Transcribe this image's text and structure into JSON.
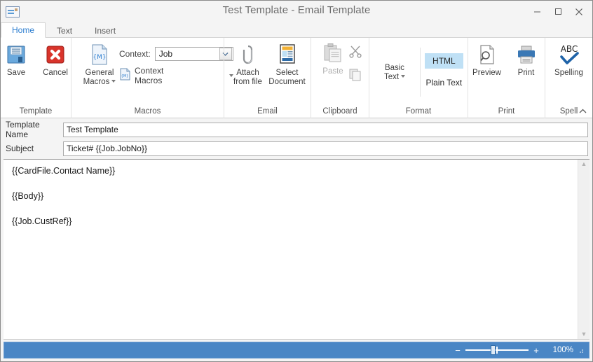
{
  "window": {
    "title": "Test Template - Email Template",
    "icon": "email-template-icon",
    "minimize_label": "Minimize",
    "maximize_label": "Maximize",
    "close_label": "Close"
  },
  "tabs": [
    {
      "label": "Home",
      "active": true
    },
    {
      "label": "Text",
      "active": false
    },
    {
      "label": "Insert",
      "active": false
    }
  ],
  "ribbon": {
    "collapse_label": "Collapse Ribbon",
    "groups": [
      {
        "label": "Template",
        "buttons": [
          {
            "label": "Save",
            "icon": "save-floppy-icon"
          },
          {
            "label": "Cancel",
            "icon": "cancel-x-icon"
          }
        ]
      },
      {
        "label": "Macros",
        "general_macros": {
          "label_line1": "General",
          "label_line2": "Macros",
          "icon": "general-macros-icon"
        },
        "context_label": "Context:",
        "context_value": "Job",
        "context_macros_label": "Context Macros",
        "context_macros_icon": "context-macros-icon"
      },
      {
        "label": "Email",
        "buttons": [
          {
            "label_line1": "Attach",
            "label_line2": "from file",
            "icon": "paperclip-icon"
          },
          {
            "label_line1": "Select",
            "label_line2": "Document",
            "icon": "document-icon"
          }
        ]
      },
      {
        "label": "Clipboard",
        "paste_label": "Paste",
        "paste_icon": "paste-icon",
        "cut_icon": "scissors-icon",
        "copy_icon": "copy-icon"
      },
      {
        "label": "Format",
        "basic_text_line1": "Basic",
        "basic_text_line2": "Text",
        "basic_text_icon": "basic-text-icon",
        "options": [
          {
            "label": "HTML",
            "selected": true
          },
          {
            "label": "Plain Text",
            "selected": false
          }
        ]
      },
      {
        "label": "Print",
        "buttons": [
          {
            "label": "Preview",
            "icon": "print-preview-icon"
          },
          {
            "label": "Print",
            "icon": "printer-icon"
          }
        ]
      },
      {
        "label": "Spell",
        "buttons": [
          {
            "label": "Spelling",
            "icon": "spell-check-icon"
          }
        ]
      }
    ]
  },
  "form": {
    "template_name_label": "Template Name",
    "template_name_value": "Test Template",
    "template_name_placeholder": "",
    "subject_label": "Subject",
    "subject_value": "Ticket# {{Job.JobNo}}",
    "subject_placeholder": ""
  },
  "editor": {
    "lines": [
      "{{CardFile.Contact Name}}",
      "{{Body}}",
      "{{Job.CustRef}}"
    ],
    "scrollbar": {
      "up_arrow": "▲",
      "down_arrow": "▼"
    }
  },
  "statusbar": {
    "zoom_out_label": "−",
    "zoom_in_label": "+",
    "zoom_percent": "100%"
  },
  "colors": {
    "accent": "#2f7fd0",
    "statusbar": "#4a86c5",
    "selected_highlight": "#bfe0f5",
    "title_text": "#6d6d6d"
  }
}
